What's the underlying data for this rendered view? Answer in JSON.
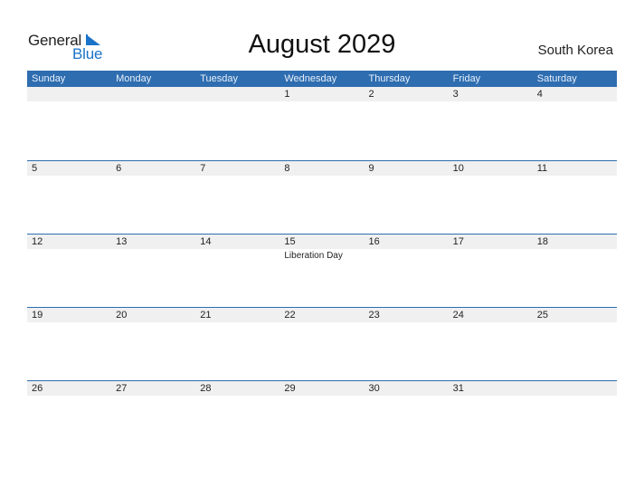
{
  "logo": {
    "text_general": "General",
    "text_blue": "Blue"
  },
  "title": "August 2029",
  "country": "South Korea",
  "colors": {
    "header_bg": "#2e6db0",
    "strip_bg": "#f0f0f0",
    "logo_blue": "#1a73c8"
  },
  "weekdays": [
    "Sunday",
    "Monday",
    "Tuesday",
    "Wednesday",
    "Thursday",
    "Friday",
    "Saturday"
  ],
  "weeks": [
    {
      "days": [
        {
          "date": ""
        },
        {
          "date": ""
        },
        {
          "date": ""
        },
        {
          "date": "1"
        },
        {
          "date": "2"
        },
        {
          "date": "3"
        },
        {
          "date": "4"
        }
      ]
    },
    {
      "days": [
        {
          "date": "5"
        },
        {
          "date": "6"
        },
        {
          "date": "7"
        },
        {
          "date": "8"
        },
        {
          "date": "9"
        },
        {
          "date": "10"
        },
        {
          "date": "11"
        }
      ]
    },
    {
      "days": [
        {
          "date": "12"
        },
        {
          "date": "13"
        },
        {
          "date": "14"
        },
        {
          "date": "15",
          "event": "Liberation Day"
        },
        {
          "date": "16"
        },
        {
          "date": "17"
        },
        {
          "date": "18"
        }
      ]
    },
    {
      "days": [
        {
          "date": "19"
        },
        {
          "date": "20"
        },
        {
          "date": "21"
        },
        {
          "date": "22"
        },
        {
          "date": "23"
        },
        {
          "date": "24"
        },
        {
          "date": "25"
        }
      ]
    },
    {
      "days": [
        {
          "date": "26"
        },
        {
          "date": "27"
        },
        {
          "date": "28"
        },
        {
          "date": "29"
        },
        {
          "date": "30"
        },
        {
          "date": "31"
        },
        {
          "date": ""
        }
      ]
    }
  ]
}
